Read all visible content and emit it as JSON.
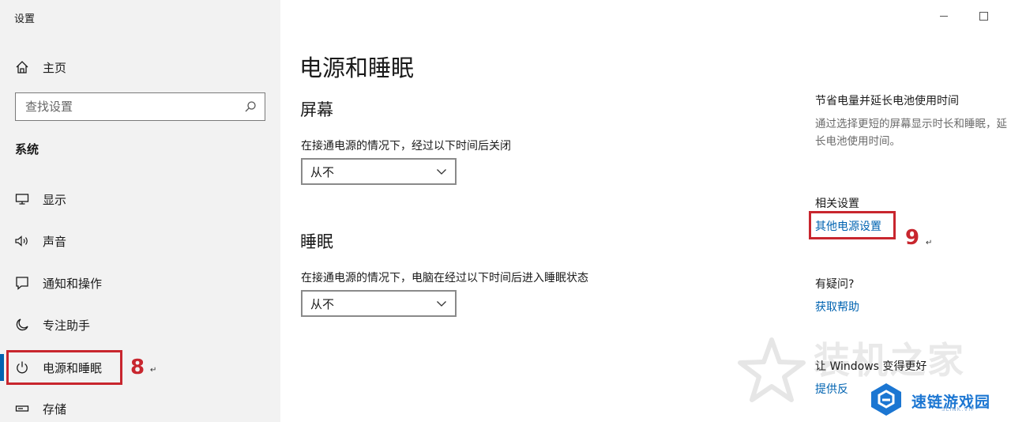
{
  "window": {
    "title": "设置"
  },
  "sidebar": {
    "home_label": "主页",
    "search_placeholder": "查找设置",
    "section_label": "系统",
    "items": [
      {
        "label": "显示",
        "icon": "display-icon"
      },
      {
        "label": "声音",
        "icon": "speaker-icon"
      },
      {
        "label": "通知和操作",
        "icon": "notification-icon"
      },
      {
        "label": "专注助手",
        "icon": "moon-icon"
      },
      {
        "label": "电源和睡眠",
        "icon": "power-icon",
        "active": true
      },
      {
        "label": "存储",
        "icon": "storage-icon"
      }
    ]
  },
  "main": {
    "title": "电源和睡眠",
    "screen": {
      "heading": "屏幕",
      "description": "在接通电源的情况下，经过以下时间后关闭",
      "value": "从不"
    },
    "sleep": {
      "heading": "睡眠",
      "description": "在接通电源的情况下，电脑在经过以下时间后进入睡眠状态",
      "value": "从不"
    }
  },
  "right_panel": {
    "battery_heading": "节省电量并延长电池使用时间",
    "battery_text": "通过选择更短的屏幕显示时长和睡眠，延长电池使用时间。",
    "related_heading": "相关设置",
    "related_link": "其他电源设置",
    "question_heading": "有疑问?",
    "help_link": "获取帮助",
    "improve_heading": "让 Windows 变得更好",
    "feedback_link": "提供反"
  },
  "annotations": {
    "step_8": "8",
    "step_9": "9"
  },
  "watermark": {
    "text": "装机之家",
    "logo_text": "速链游戏园",
    "logo_sub": "SLINK.VIP"
  },
  "colors": {
    "accent": "#0063b1",
    "annotation_red": "#c8262e",
    "sidebar_bg": "#f2f2f2"
  }
}
